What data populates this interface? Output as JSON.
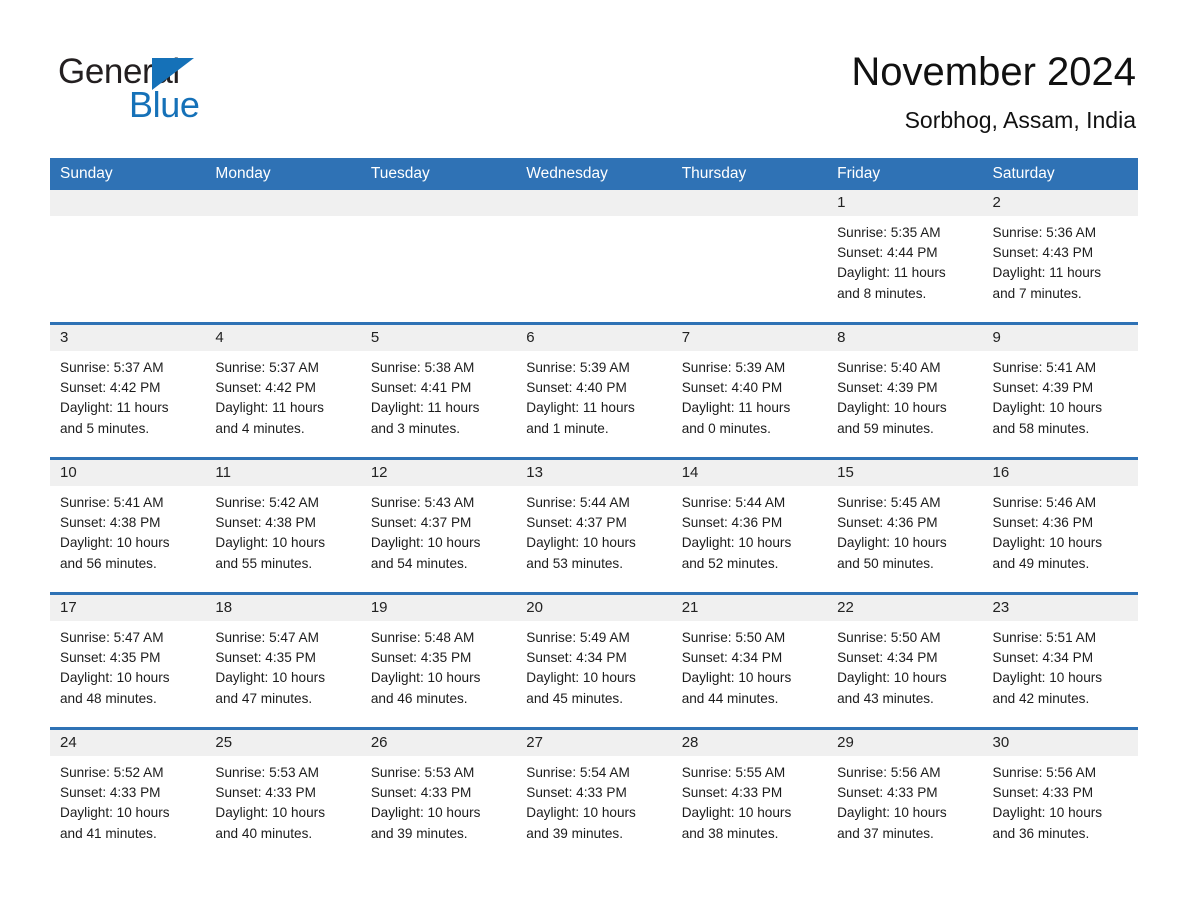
{
  "brand": {
    "word_one": "General",
    "word_two": "Blue",
    "triangle_icon": "triangle-right-icon",
    "accent_color": "#1571b8"
  },
  "header": {
    "title": "November 2024",
    "subtitle": "Sorbhog, Assam, India"
  },
  "calendar": {
    "header_background": "#2f72b5",
    "daynum_background": "#f0f0f0",
    "weekday_headers": [
      "Sunday",
      "Monday",
      "Tuesday",
      "Wednesday",
      "Thursday",
      "Friday",
      "Saturday"
    ],
    "weeks": [
      [
        {
          "day": "",
          "sunrise": "",
          "sunset": "",
          "daylight_line1": "",
          "daylight_line2": ""
        },
        {
          "day": "",
          "sunrise": "",
          "sunset": "",
          "daylight_line1": "",
          "daylight_line2": ""
        },
        {
          "day": "",
          "sunrise": "",
          "sunset": "",
          "daylight_line1": "",
          "daylight_line2": ""
        },
        {
          "day": "",
          "sunrise": "",
          "sunset": "",
          "daylight_line1": "",
          "daylight_line2": ""
        },
        {
          "day": "",
          "sunrise": "",
          "sunset": "",
          "daylight_line1": "",
          "daylight_line2": ""
        },
        {
          "day": "1",
          "sunrise": "Sunrise: 5:35 AM",
          "sunset": "Sunset: 4:44 PM",
          "daylight_line1": "Daylight: 11 hours",
          "daylight_line2": "and 8 minutes."
        },
        {
          "day": "2",
          "sunrise": "Sunrise: 5:36 AM",
          "sunset": "Sunset: 4:43 PM",
          "daylight_line1": "Daylight: 11 hours",
          "daylight_line2": "and 7 minutes."
        }
      ],
      [
        {
          "day": "3",
          "sunrise": "Sunrise: 5:37 AM",
          "sunset": "Sunset: 4:42 PM",
          "daylight_line1": "Daylight: 11 hours",
          "daylight_line2": "and 5 minutes."
        },
        {
          "day": "4",
          "sunrise": "Sunrise: 5:37 AM",
          "sunset": "Sunset: 4:42 PM",
          "daylight_line1": "Daylight: 11 hours",
          "daylight_line2": "and 4 minutes."
        },
        {
          "day": "5",
          "sunrise": "Sunrise: 5:38 AM",
          "sunset": "Sunset: 4:41 PM",
          "daylight_line1": "Daylight: 11 hours",
          "daylight_line2": "and 3 minutes."
        },
        {
          "day": "6",
          "sunrise": "Sunrise: 5:39 AM",
          "sunset": "Sunset: 4:40 PM",
          "daylight_line1": "Daylight: 11 hours",
          "daylight_line2": "and 1 minute."
        },
        {
          "day": "7",
          "sunrise": "Sunrise: 5:39 AM",
          "sunset": "Sunset: 4:40 PM",
          "daylight_line1": "Daylight: 11 hours",
          "daylight_line2": "and 0 minutes."
        },
        {
          "day": "8",
          "sunrise": "Sunrise: 5:40 AM",
          "sunset": "Sunset: 4:39 PM",
          "daylight_line1": "Daylight: 10 hours",
          "daylight_line2": "and 59 minutes."
        },
        {
          "day": "9",
          "sunrise": "Sunrise: 5:41 AM",
          "sunset": "Sunset: 4:39 PM",
          "daylight_line1": "Daylight: 10 hours",
          "daylight_line2": "and 58 minutes."
        }
      ],
      [
        {
          "day": "10",
          "sunrise": "Sunrise: 5:41 AM",
          "sunset": "Sunset: 4:38 PM",
          "daylight_line1": "Daylight: 10 hours",
          "daylight_line2": "and 56 minutes."
        },
        {
          "day": "11",
          "sunrise": "Sunrise: 5:42 AM",
          "sunset": "Sunset: 4:38 PM",
          "daylight_line1": "Daylight: 10 hours",
          "daylight_line2": "and 55 minutes."
        },
        {
          "day": "12",
          "sunrise": "Sunrise: 5:43 AM",
          "sunset": "Sunset: 4:37 PM",
          "daylight_line1": "Daylight: 10 hours",
          "daylight_line2": "and 54 minutes."
        },
        {
          "day": "13",
          "sunrise": "Sunrise: 5:44 AM",
          "sunset": "Sunset: 4:37 PM",
          "daylight_line1": "Daylight: 10 hours",
          "daylight_line2": "and 53 minutes."
        },
        {
          "day": "14",
          "sunrise": "Sunrise: 5:44 AM",
          "sunset": "Sunset: 4:36 PM",
          "daylight_line1": "Daylight: 10 hours",
          "daylight_line2": "and 52 minutes."
        },
        {
          "day": "15",
          "sunrise": "Sunrise: 5:45 AM",
          "sunset": "Sunset: 4:36 PM",
          "daylight_line1": "Daylight: 10 hours",
          "daylight_line2": "and 50 minutes."
        },
        {
          "day": "16",
          "sunrise": "Sunrise: 5:46 AM",
          "sunset": "Sunset: 4:36 PM",
          "daylight_line1": "Daylight: 10 hours",
          "daylight_line2": "and 49 minutes."
        }
      ],
      [
        {
          "day": "17",
          "sunrise": "Sunrise: 5:47 AM",
          "sunset": "Sunset: 4:35 PM",
          "daylight_line1": "Daylight: 10 hours",
          "daylight_line2": "and 48 minutes."
        },
        {
          "day": "18",
          "sunrise": "Sunrise: 5:47 AM",
          "sunset": "Sunset: 4:35 PM",
          "daylight_line1": "Daylight: 10 hours",
          "daylight_line2": "and 47 minutes."
        },
        {
          "day": "19",
          "sunrise": "Sunrise: 5:48 AM",
          "sunset": "Sunset: 4:35 PM",
          "daylight_line1": "Daylight: 10 hours",
          "daylight_line2": "and 46 minutes."
        },
        {
          "day": "20",
          "sunrise": "Sunrise: 5:49 AM",
          "sunset": "Sunset: 4:34 PM",
          "daylight_line1": "Daylight: 10 hours",
          "daylight_line2": "and 45 minutes."
        },
        {
          "day": "21",
          "sunrise": "Sunrise: 5:50 AM",
          "sunset": "Sunset: 4:34 PM",
          "daylight_line1": "Daylight: 10 hours",
          "daylight_line2": "and 44 minutes."
        },
        {
          "day": "22",
          "sunrise": "Sunrise: 5:50 AM",
          "sunset": "Sunset: 4:34 PM",
          "daylight_line1": "Daylight: 10 hours",
          "daylight_line2": "and 43 minutes."
        },
        {
          "day": "23",
          "sunrise": "Sunrise: 5:51 AM",
          "sunset": "Sunset: 4:34 PM",
          "daylight_line1": "Daylight: 10 hours",
          "daylight_line2": "and 42 minutes."
        }
      ],
      [
        {
          "day": "24",
          "sunrise": "Sunrise: 5:52 AM",
          "sunset": "Sunset: 4:33 PM",
          "daylight_line1": "Daylight: 10 hours",
          "daylight_line2": "and 41 minutes."
        },
        {
          "day": "25",
          "sunrise": "Sunrise: 5:53 AM",
          "sunset": "Sunset: 4:33 PM",
          "daylight_line1": "Daylight: 10 hours",
          "daylight_line2": "and 40 minutes."
        },
        {
          "day": "26",
          "sunrise": "Sunrise: 5:53 AM",
          "sunset": "Sunset: 4:33 PM",
          "daylight_line1": "Daylight: 10 hours",
          "daylight_line2": "and 39 minutes."
        },
        {
          "day": "27",
          "sunrise": "Sunrise: 5:54 AM",
          "sunset": "Sunset: 4:33 PM",
          "daylight_line1": "Daylight: 10 hours",
          "daylight_line2": "and 39 minutes."
        },
        {
          "day": "28",
          "sunrise": "Sunrise: 5:55 AM",
          "sunset": "Sunset: 4:33 PM",
          "daylight_line1": "Daylight: 10 hours",
          "daylight_line2": "and 38 minutes."
        },
        {
          "day": "29",
          "sunrise": "Sunrise: 5:56 AM",
          "sunset": "Sunset: 4:33 PM",
          "daylight_line1": "Daylight: 10 hours",
          "daylight_line2": "and 37 minutes."
        },
        {
          "day": "30",
          "sunrise": "Sunrise: 5:56 AM",
          "sunset": "Sunset: 4:33 PM",
          "daylight_line1": "Daylight: 10 hours",
          "daylight_line2": "and 36 minutes."
        }
      ]
    ]
  }
}
